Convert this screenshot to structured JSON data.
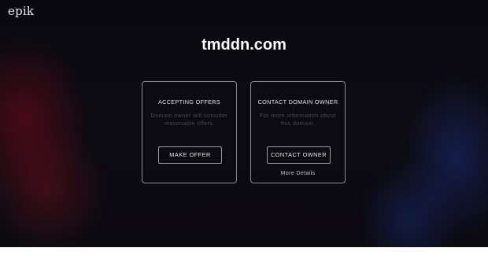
{
  "logo": "epik",
  "domain": "tmddn.com",
  "cards": [
    {
      "title": "ACCEPTING OFFERS",
      "description": "Domain owner will consider reasonable offers.",
      "button": "MAKE OFFER"
    },
    {
      "title": "CONTACT DOMAIN OWNER",
      "description": "For more information about this domain.",
      "button": "CONTACT OWNER",
      "link": "More Details"
    }
  ],
  "colors": {
    "background": "#0b0a10",
    "accent_red": "#780a19",
    "accent_blue": "#192d78",
    "card_border": "#8a8a90"
  }
}
